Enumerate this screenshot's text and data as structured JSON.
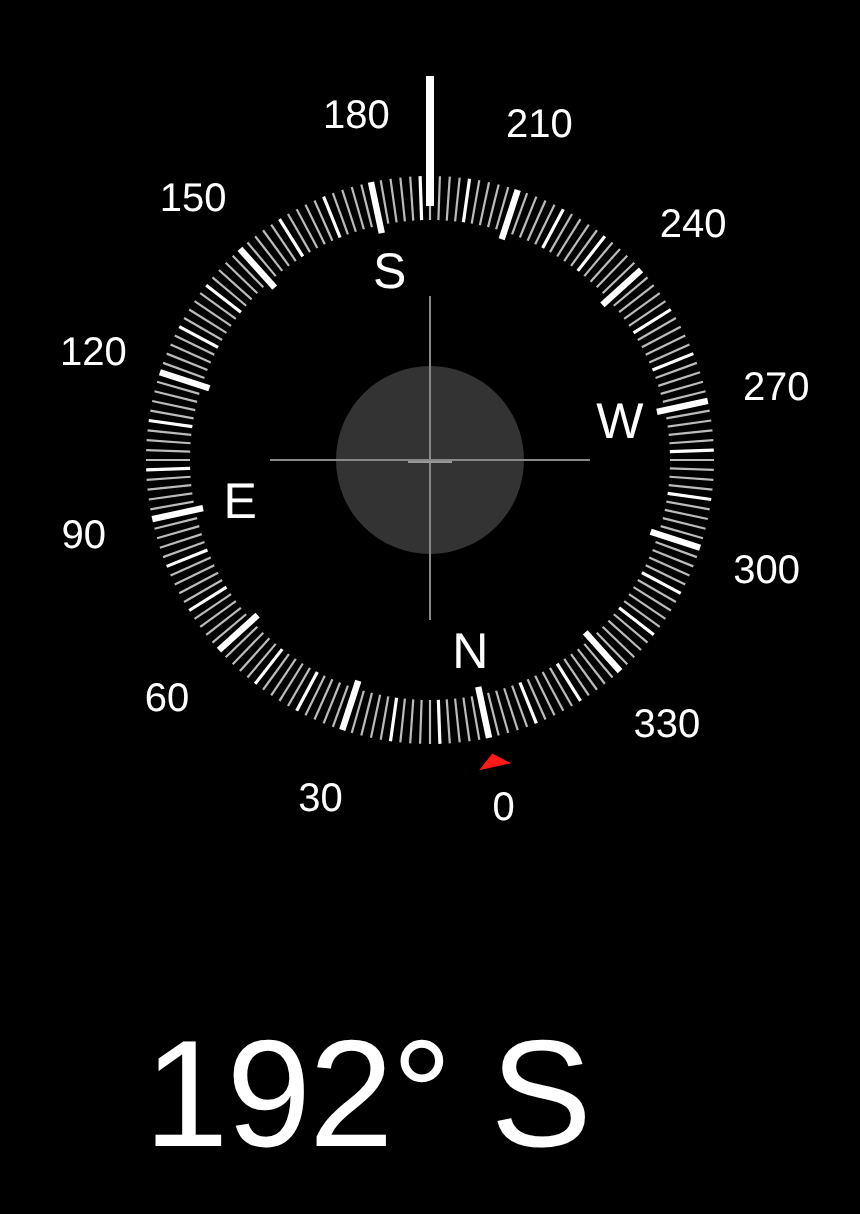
{
  "compass": {
    "degree_labels": [
      "0",
      "30",
      "60",
      "90",
      "120",
      "150",
      "180",
      "210",
      "240",
      "270",
      "300",
      "330"
    ],
    "cardinals": [
      "N",
      "E",
      "S",
      "W"
    ]
  },
  "readout": {
    "heading": "192° S"
  }
}
